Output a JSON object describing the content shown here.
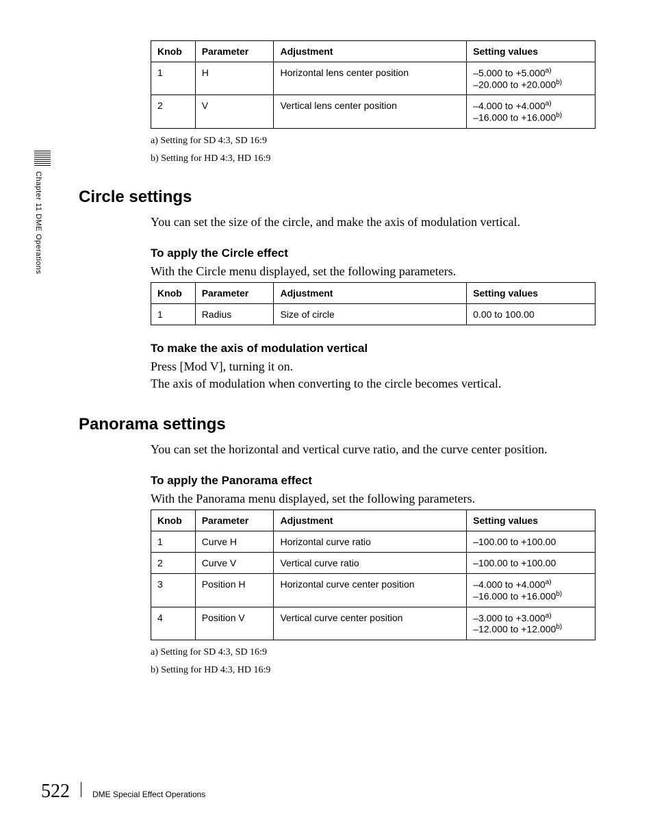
{
  "sidebar": {
    "chapter": "Chapter 11  DME Operations"
  },
  "table1": {
    "headers": {
      "knob": "Knob",
      "parameter": "Parameter",
      "adjustment": "Adjustment",
      "setting": "Setting values"
    },
    "rows": [
      {
        "knob": "1",
        "param": "H",
        "adj": "Horizontal lens center position",
        "s1": "–5.000 to +5.000",
        "n1": "a)",
        "s2": "–20.000 to +20.000",
        "n2": "b)"
      },
      {
        "knob": "2",
        "param": "V",
        "adj": "Vertical lens center position",
        "s1": "–4.000 to +4.000",
        "n1": "a)",
        "s2": "–16.000 to +16.000",
        "n2": "b)"
      }
    ],
    "fn_a": "a) Setting for SD 4:3, SD 16:9",
    "fn_b": "b) Setting for HD 4:3, HD 16:9"
  },
  "circle": {
    "title": "Circle settings",
    "intro": "You can set the size of the circle, and make the axis of modulation vertical.",
    "sub1": "To apply the Circle effect",
    "sub1_text": "With the Circle menu displayed, set the following parameters.",
    "table": {
      "headers": {
        "knob": "Knob",
        "parameter": "Parameter",
        "adjustment": "Adjustment",
        "setting": "Setting values"
      },
      "rows": [
        {
          "knob": "1",
          "param": "Radius",
          "adj": "Size of circle",
          "setting": "0.00 to 100.00"
        }
      ]
    },
    "sub2": "To make the axis of modulation vertical",
    "sub2_line1": "Press [Mod V], turning it on.",
    "sub2_line2": "The axis of modulation when converting to the circle becomes vertical."
  },
  "panorama": {
    "title": "Panorama settings",
    "intro": "You can set the horizontal and vertical curve ratio, and the curve center position.",
    "sub1": "To apply the Panorama effect",
    "sub1_text": "With the Panorama menu displayed, set the following parameters.",
    "table": {
      "headers": {
        "knob": "Knob",
        "parameter": "Parameter",
        "adjustment": "Adjustment",
        "setting": "Setting values"
      },
      "rows": [
        {
          "knob": "1",
          "param": "Curve H",
          "adj": "Horizontal curve ratio",
          "s1": "–100.00 to +100.00",
          "n1": "",
          "s2": "",
          "n2": ""
        },
        {
          "knob": "2",
          "param": "Curve V",
          "adj": "Vertical curve ratio",
          "s1": "–100.00 to +100.00",
          "n1": "",
          "s2": "",
          "n2": ""
        },
        {
          "knob": "3",
          "param": "Position H",
          "adj": "Horizontal curve center position",
          "s1": "–4.000 to +4.000",
          "n1": "a)",
          "s2": "–16.000 to +16.000",
          "n2": "b)"
        },
        {
          "knob": "4",
          "param": "Position V",
          "adj": "Vertical curve center position",
          "s1": "–3.000 to +3.000",
          "n1": "a)",
          "s2": "–12.000 to +12.000",
          "n2": "b)"
        }
      ]
    },
    "fn_a": "a) Setting for SD 4:3, SD 16:9",
    "fn_b": "b) Setting for HD 4:3, HD 16:9"
  },
  "footer": {
    "page": "522",
    "section": "DME Special Effect Operations"
  }
}
